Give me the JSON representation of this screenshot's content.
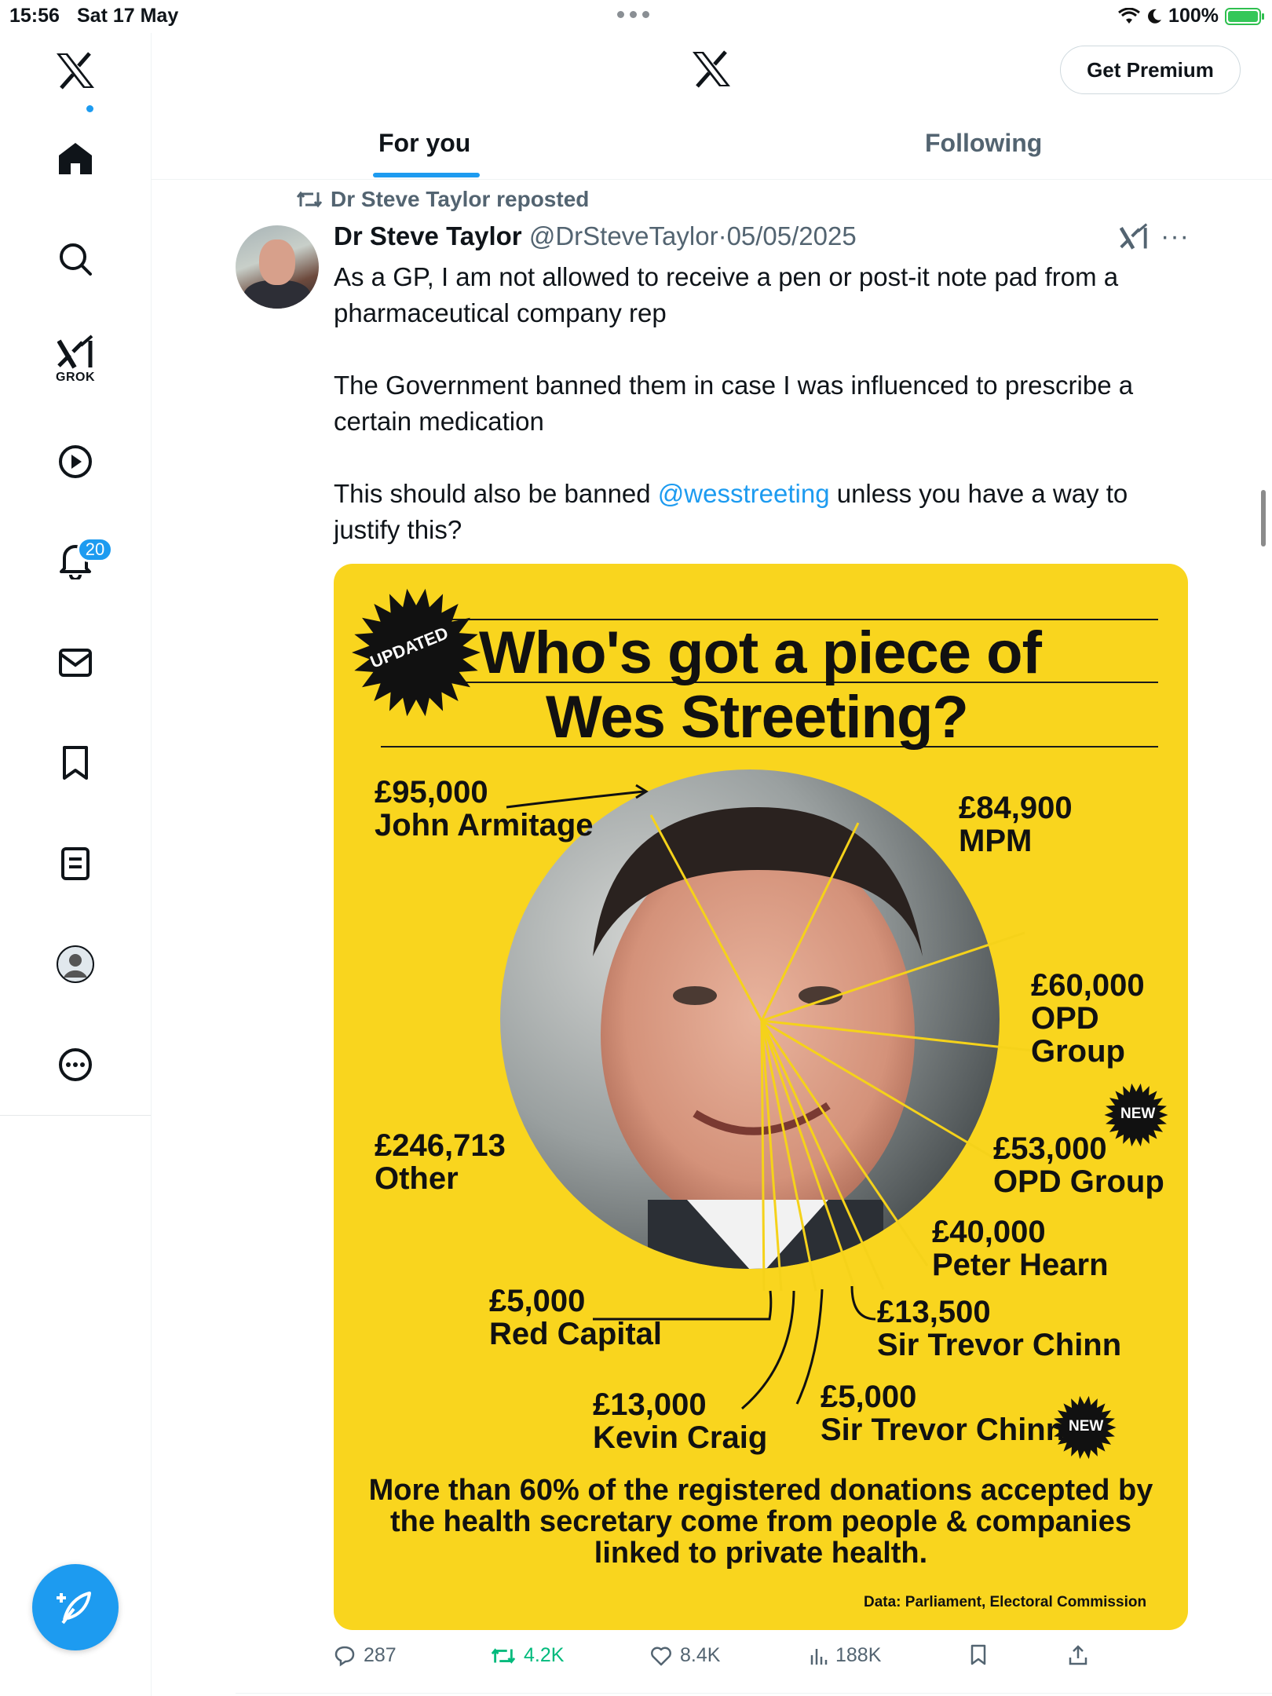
{
  "status_bar": {
    "time": "15:56",
    "date": "Sat 17 May",
    "battery": "100%",
    "battery_level": 1.0
  },
  "sidebar": {
    "grok_label": "GROK",
    "notifications_count": "20",
    "items": [
      "x-logo-icon",
      "home-icon",
      "search-icon",
      "grok-icon",
      "video-icon",
      "notifications-icon",
      "messages-icon",
      "bookmarks-icon",
      "lists-icon",
      "profile-icon",
      "more-icon"
    ]
  },
  "header": {
    "premium_label": "Get Premium",
    "tabs": [
      {
        "label": "For you",
        "active": true
      },
      {
        "label": "Following",
        "active": false
      }
    ]
  },
  "tweet": {
    "repost_text": "Dr Steve Taylor reposted",
    "name": "Dr Steve Taylor",
    "handle": "@DrSteveTaylor",
    "separator": "·",
    "date": "05/05/2025",
    "more_label": "···",
    "paragraph1": "As a GP, I am not allowed to receive a pen or post-it note pad from a pharmaceutical company rep",
    "paragraph2": "The Government banned them in case I was influenced to prescribe a certain medication",
    "paragraph3_before": "This should also be banned ",
    "mention": "@wesstreeting",
    "paragraph3_after": " unless you have a way to justify this?",
    "media": {
      "badge_updated": "UPDATED",
      "title_line1": "Who's got a piece of",
      "title_line2": "Wes Streeting?",
      "badge_new": "NEW",
      "labels": [
        {
          "amount": "£95,000",
          "name": "John Armitage"
        },
        {
          "amount": "£84,900",
          "name": "MPM"
        },
        {
          "amount": "£60,000",
          "name": "OPD",
          "name2": "Group"
        },
        {
          "amount": "£53,000",
          "name": "OPD Group"
        },
        {
          "amount": "£40,000",
          "name": "Peter Hearn"
        },
        {
          "amount": "£13,500",
          "name": "Sir Trevor Chinn"
        },
        {
          "amount": "£5,000",
          "name": "Sir Trevor Chinn"
        },
        {
          "amount": "£13,000",
          "name": "Kevin Craig"
        },
        {
          "amount": "£5,000",
          "name": "Red Capital"
        },
        {
          "amount": "£246,713",
          "name": "Other"
        }
      ],
      "footer": "More than 60% of the registered donations accepted by the health secretary come from people & companies linked to private health.",
      "source": "Data: Parliament, Electoral Commission"
    },
    "actions": {
      "replies": "287",
      "reposts": "4.2K",
      "likes": "8.4K",
      "views": "188K"
    }
  },
  "colors": {
    "accent": "#1d9bf0",
    "repost_green": "#00ba7c",
    "media_yellow": "#f9d51e",
    "text_primary": "#0f1419",
    "text_secondary": "#536471"
  }
}
